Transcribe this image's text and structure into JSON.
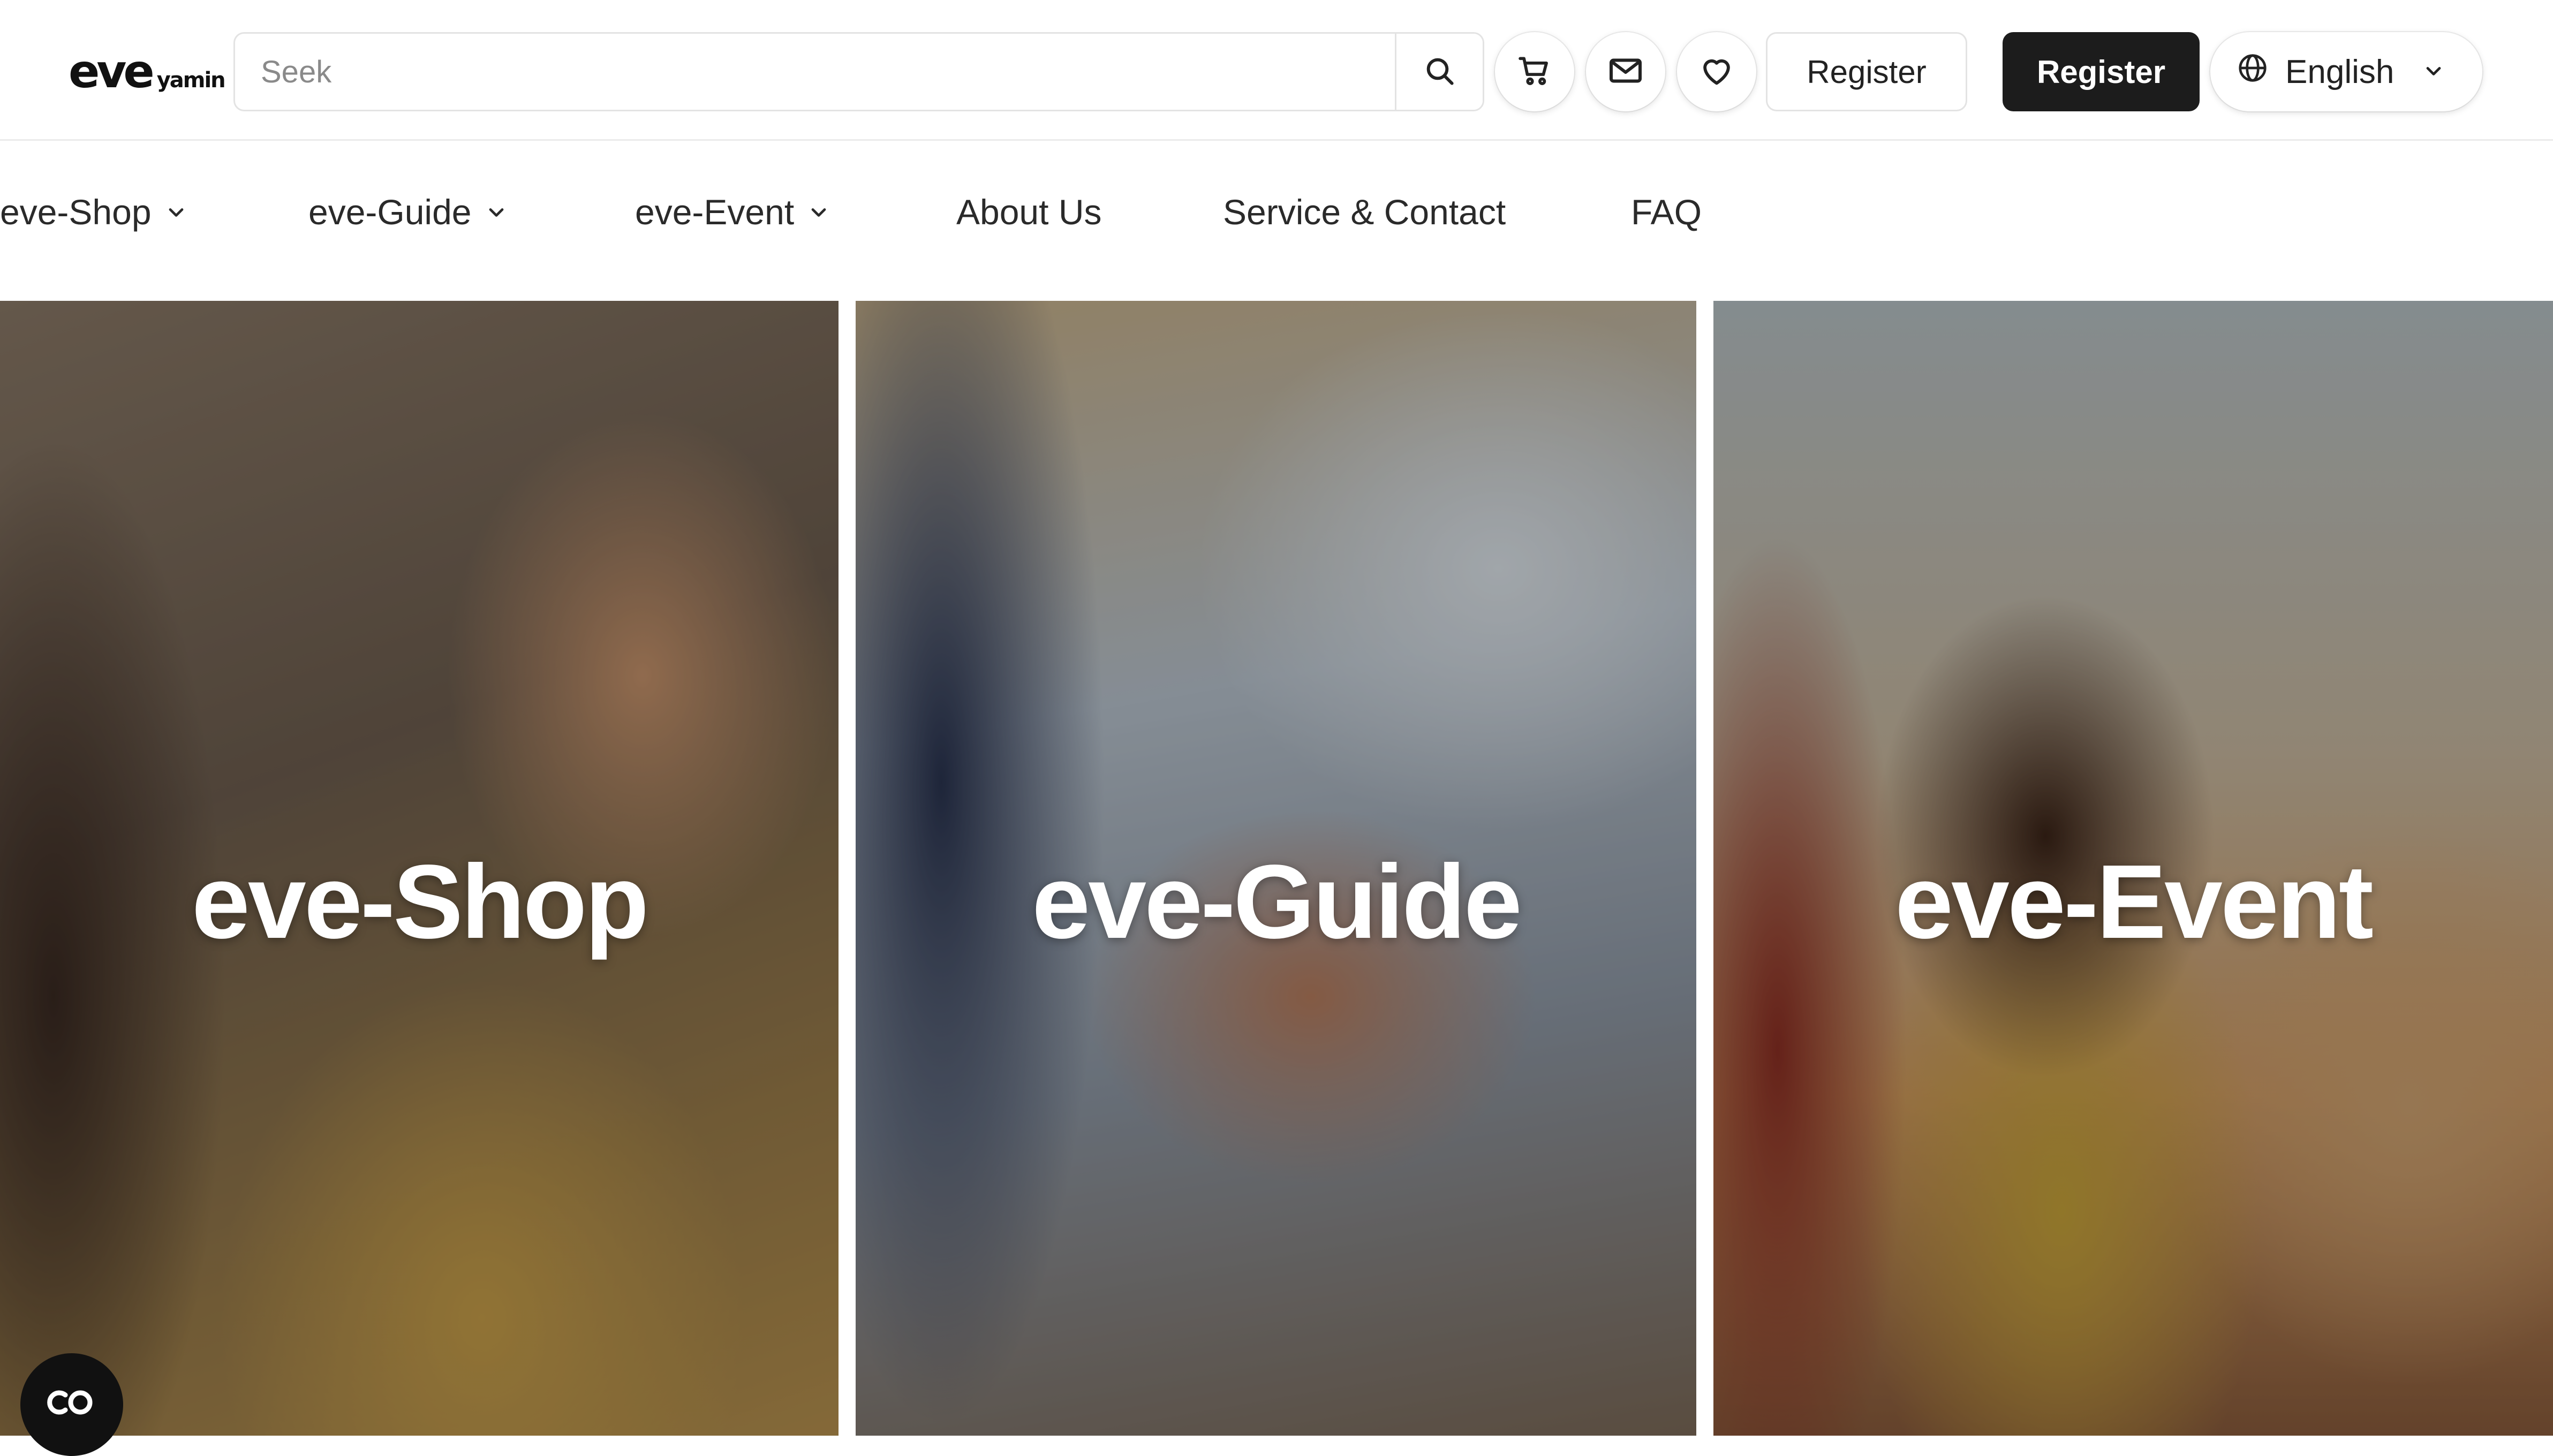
{
  "header": {
    "logo_main": "eve",
    "logo_sub": "yamin",
    "search": {
      "placeholder": "Seek",
      "value": ""
    },
    "register_outline_label": "Register",
    "register_primary_label": "Register",
    "language": {
      "selected": "English"
    },
    "icons": [
      "search-icon",
      "cart-icon",
      "mail-icon",
      "heart-icon",
      "globe-icon",
      "chevron-down-icon"
    ]
  },
  "nav": {
    "items": [
      {
        "label": "eve-Shop",
        "dropdown": true
      },
      {
        "label": "eve-Guide",
        "dropdown": true
      },
      {
        "label": "eve-Event",
        "dropdown": true
      },
      {
        "label": "About Us",
        "dropdown": false
      },
      {
        "label": "Service & Contact",
        "dropdown": false
      },
      {
        "label": "FAQ",
        "dropdown": false
      }
    ]
  },
  "tiles": [
    {
      "label": "eve-Shop"
    },
    {
      "label": "eve-Guide"
    },
    {
      "label": "eve-Event"
    }
  ],
  "colors": {
    "primary_button_bg": "#1c1c1c",
    "primary_button_text": "#ffffff",
    "border": "#e3e3e3",
    "text": "#222222",
    "tile_text": "#ffffff"
  }
}
